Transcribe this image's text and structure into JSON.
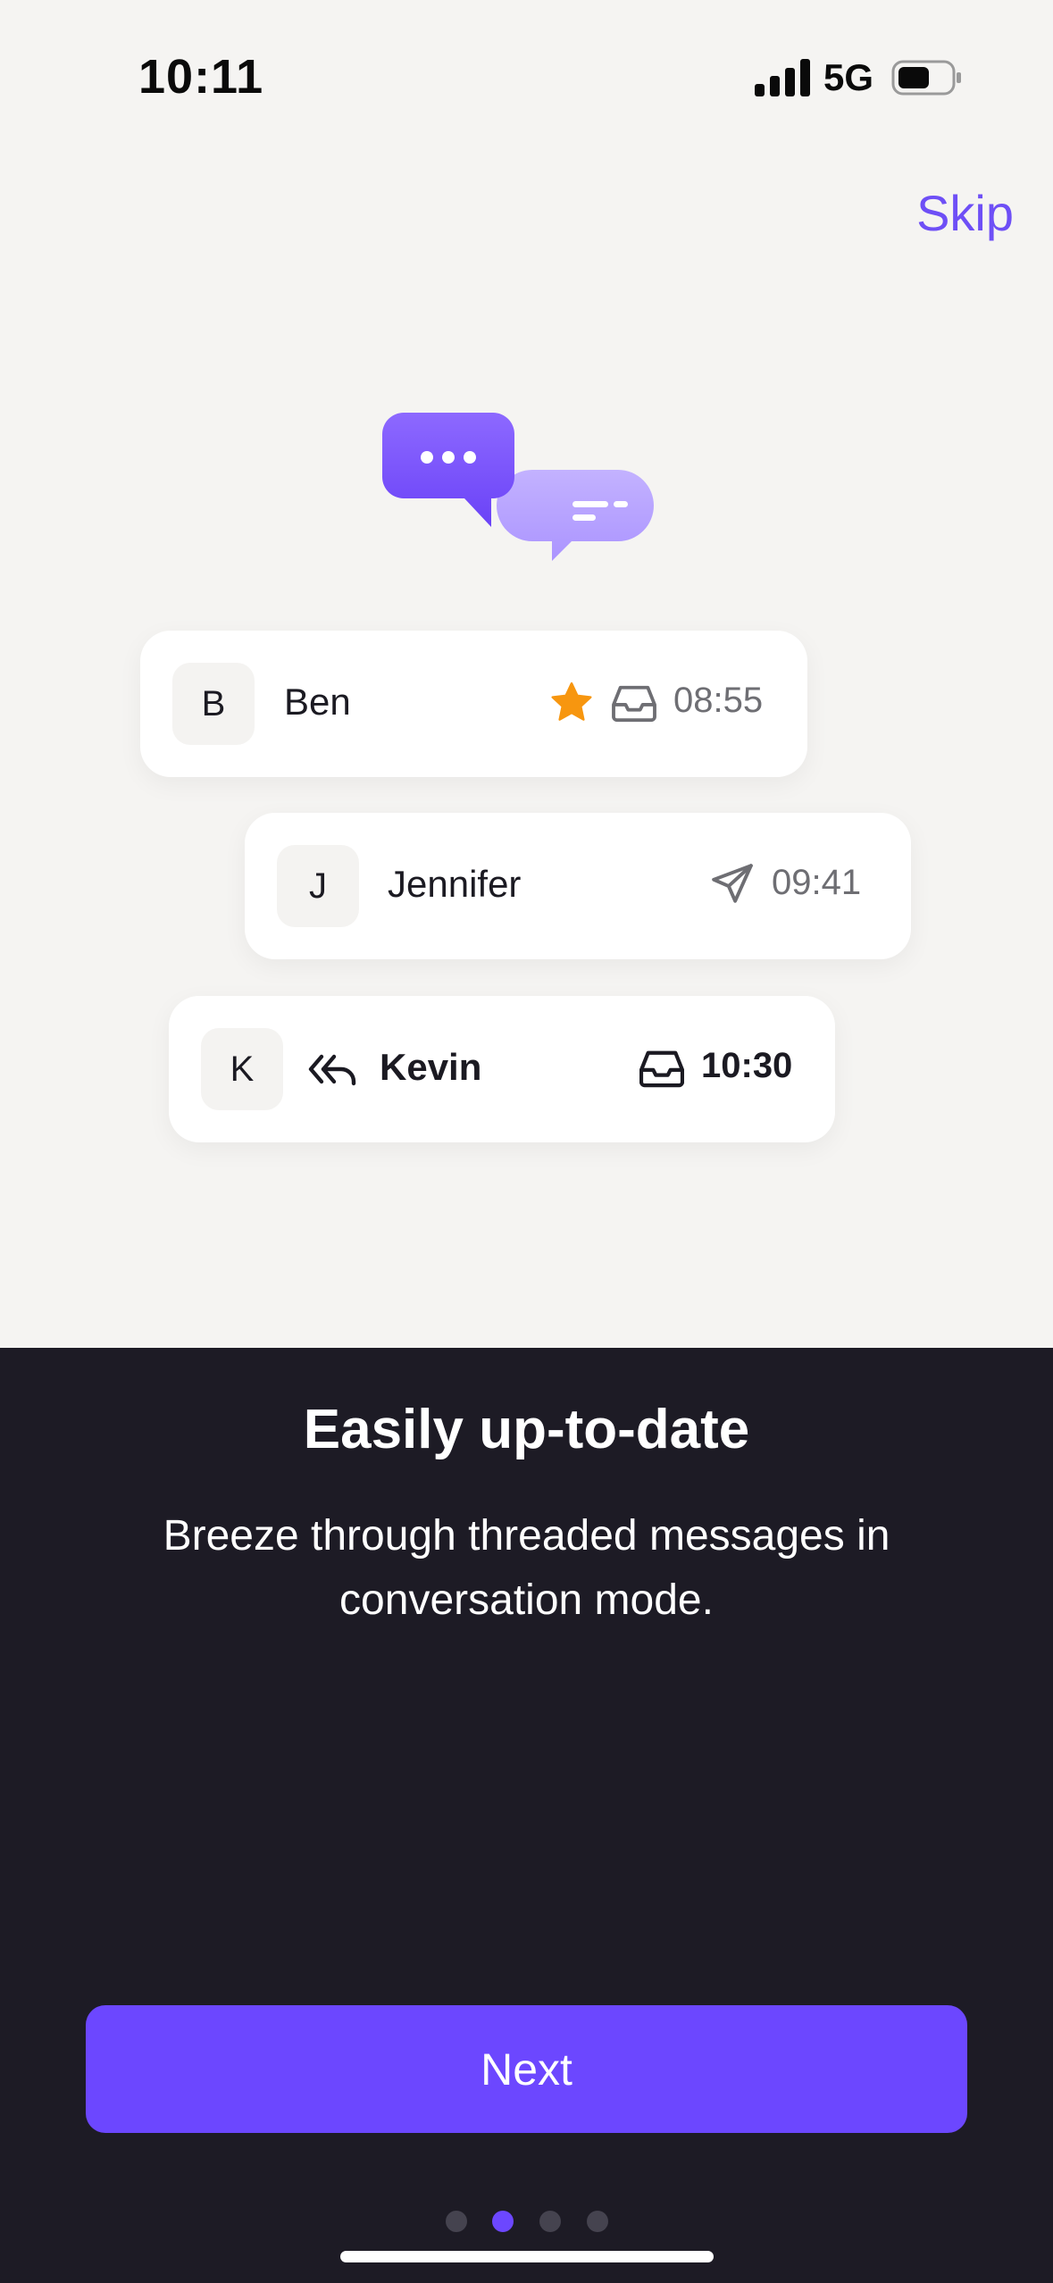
{
  "status_bar": {
    "time": "10:11",
    "network": "5G"
  },
  "header": {
    "skip_label": "Skip"
  },
  "conversations": [
    {
      "initial": "B",
      "name": "Ben",
      "time": "08:55",
      "starred": true,
      "icon": "inbox-icon"
    },
    {
      "initial": "J",
      "name": "Jennifer",
      "time": "09:41",
      "starred": false,
      "icon": "send-icon"
    },
    {
      "initial": "K",
      "name": "Kevin",
      "time": "10:30",
      "starred": false,
      "icon": "inbox-icon",
      "unread": true,
      "replied": true
    }
  ],
  "onboarding": {
    "title": "Easily up-to-date",
    "description": "Breeze through threaded messages in conversation mode.",
    "next_label": "Next",
    "page_index": 2,
    "page_count": 4
  },
  "colors": {
    "accent": "#6c47ff",
    "dark_bg": "#1d1b25",
    "light_bg": "#f5f4f2",
    "star": "#f7960f"
  }
}
